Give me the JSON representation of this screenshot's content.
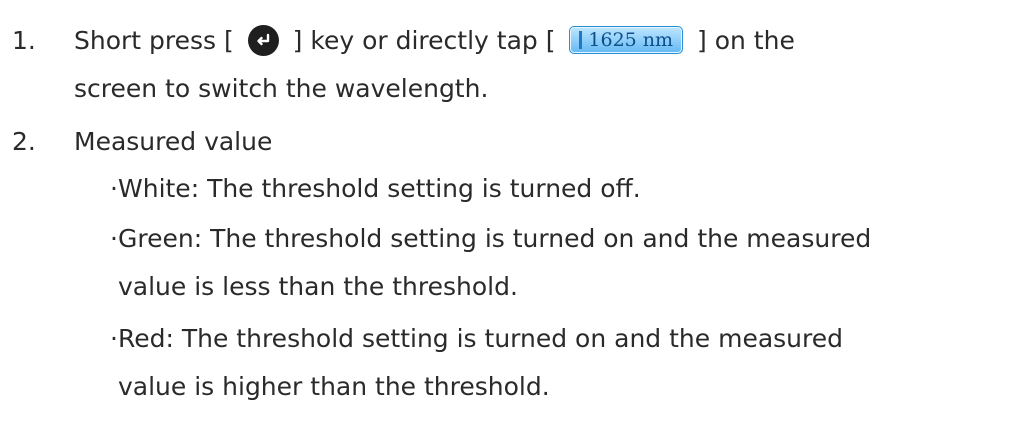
{
  "steps": [
    {
      "number": "1.",
      "prefix": "Short press [",
      "key_icon": "enter-key-icon",
      "middle": "] key or directly tap [",
      "button_label": "1625 nm",
      "suffix": "] on the",
      "continuation": "screen to switch the wavelength."
    },
    {
      "number": "2.",
      "title": "Measured value",
      "bullets": [
        {
          "marker": "·",
          "line1": "White: The threshold setting is turned off."
        },
        {
          "marker": "·",
          "line1": "Green: The threshold setting is turned on and the measured",
          "line2": "value is less than the threshold."
        },
        {
          "marker": "·",
          "line1": "Red: The threshold setting is turned on and the measured",
          "line2": "value is higher than the threshold."
        }
      ]
    }
  ],
  "colors": {
    "text": "#2a2a2a",
    "key_fill": "#1f1f1f",
    "button_fill": "#63b9f5",
    "button_text": "#0d4f8a"
  }
}
